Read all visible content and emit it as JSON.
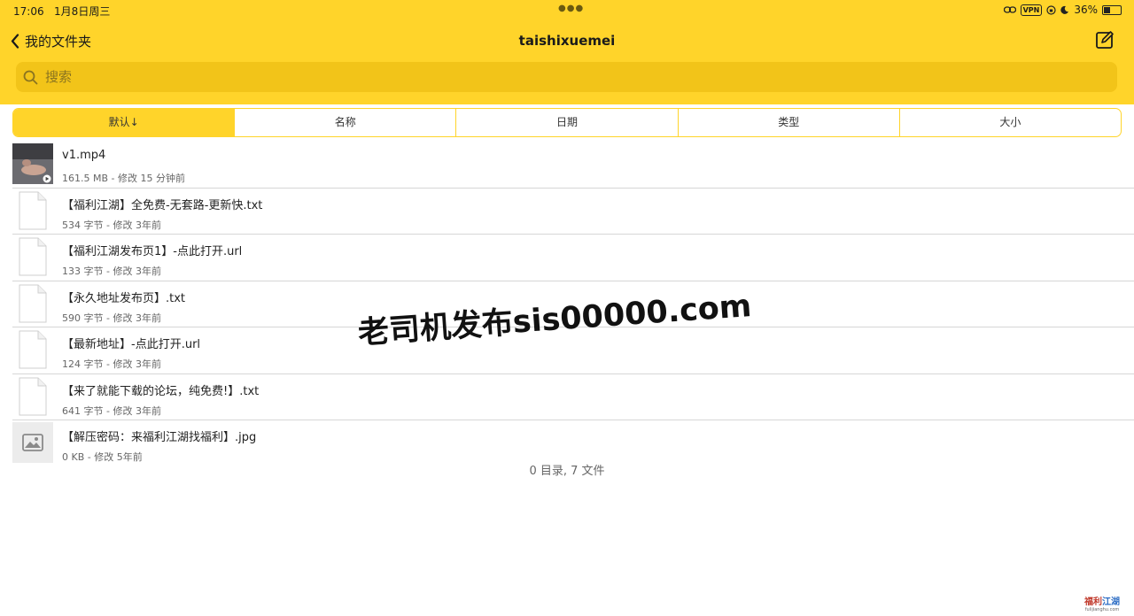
{
  "status": {
    "time": "17:06",
    "date": "1月8日周三",
    "vpn": "VPN",
    "battery": "36%",
    "battery_level": 0.36
  },
  "nav": {
    "back_label": "我的文件夹",
    "title": "taishixuemei"
  },
  "search": {
    "placeholder": "搜索",
    "value": ""
  },
  "sort_tabs": [
    {
      "label": "默认↓",
      "active": true
    },
    {
      "label": "名称",
      "active": false
    },
    {
      "label": "日期",
      "active": false
    },
    {
      "label": "类型",
      "active": false
    },
    {
      "label": "大小",
      "active": false
    }
  ],
  "files": [
    {
      "name": "v1.mp4",
      "meta": "161.5 MB - 修改 15 分钟前",
      "icon": "video-thumbnail"
    },
    {
      "name": "【福利江湖】全免费-无套路-更新快.txt",
      "meta": "534 字节 - 修改 3年前",
      "icon": "document-icon"
    },
    {
      "name": "【福利江湖发布页1】-点此打开.url",
      "meta": "133 字节 - 修改 3年前",
      "icon": "document-icon"
    },
    {
      "name": "【永久地址发布页】.txt",
      "meta": "590 字节 - 修改 3年前",
      "icon": "document-icon"
    },
    {
      "name": "【最新地址】-点此打开.url",
      "meta": "124 字节 - 修改 3年前",
      "icon": "document-icon"
    },
    {
      "name": "【来了就能下载的论坛，纯免费!】.txt",
      "meta": "641 字节 - 修改 3年前",
      "icon": "document-icon"
    },
    {
      "name": "【解压密码：来福利江湖找福利】.jpg",
      "meta": "0 KB - 修改 5年前",
      "icon": "image-placeholder-icon"
    }
  ],
  "summary": "0 目录, 7 文件",
  "watermark": "老司机发布sis00000.com",
  "corner_logo": {
    "line1a": "福利",
    "line1b": "江湖",
    "line2": "fulijianghu.com"
  },
  "colors": {
    "accent": "#FFD42A",
    "search_bg": "#F2C419"
  }
}
